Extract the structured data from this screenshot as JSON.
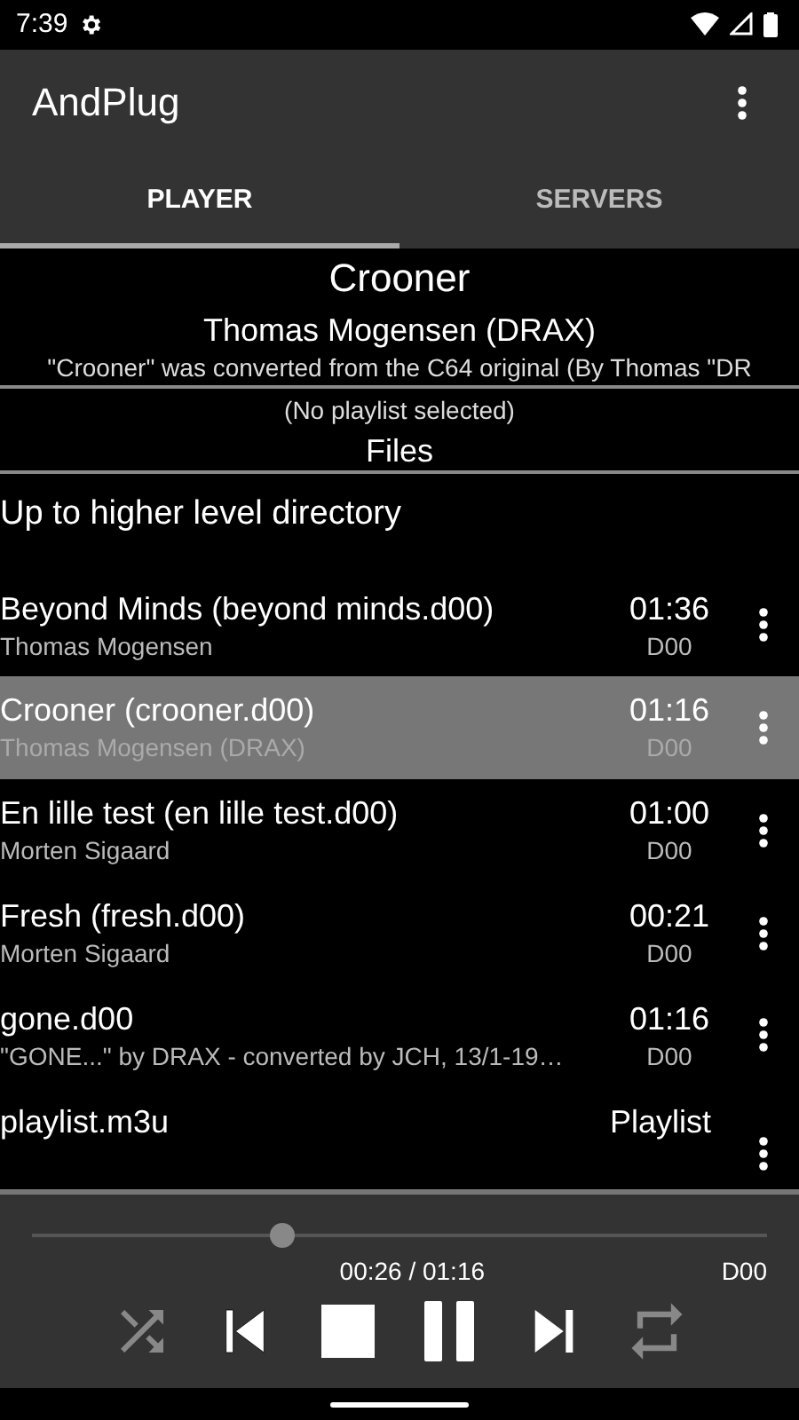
{
  "status_bar": {
    "time": "7:39"
  },
  "app_bar": {
    "title": "AndPlug"
  },
  "tabs": [
    {
      "label": "PLAYER",
      "selected": true
    },
    {
      "label": "SERVERS",
      "selected": false
    }
  ],
  "now_playing": {
    "title": "Crooner",
    "artist": "Thomas Mogensen (DRAX)",
    "comment": "\"Crooner\" was converted from the C64 original (By Thomas \"DR"
  },
  "playlist_status": "(No playlist selected)",
  "files_heading": "Files",
  "files": [
    {
      "kind": "directory",
      "name": "Up to higher level directory",
      "selected": false
    },
    {
      "kind": "song",
      "name": "Beyond Minds (beyond minds.d00)",
      "author": "Thomas Mogensen",
      "duration": "01:36",
      "format": "D00",
      "selected": false
    },
    {
      "kind": "song",
      "name": "Crooner (crooner.d00)",
      "author": "Thomas Mogensen (DRAX)",
      "duration": "01:16",
      "format": "D00",
      "selected": true
    },
    {
      "kind": "song",
      "name": "En lille test (en lille test.d00)",
      "author": "Morten Sigaard",
      "duration": "01:00",
      "format": "D00",
      "selected": false
    },
    {
      "kind": "song",
      "name": "Fresh (fresh.d00)",
      "author": "Morten Sigaard",
      "duration": "00:21",
      "format": "D00",
      "selected": false
    },
    {
      "kind": "song",
      "name": "gone.d00",
      "author": "\"GONE...\" by DRAX - converted by JCH, 13/1-19…",
      "duration": "01:16",
      "format": "D00",
      "selected": false
    },
    {
      "kind": "playlist",
      "name": "playlist.m3u",
      "type_label": "Playlist",
      "selected": false
    }
  ],
  "player": {
    "level": 0.34,
    "time": "00:26 / 01:16",
    "format": "D00",
    "shuffle": false,
    "repeat": false
  }
}
